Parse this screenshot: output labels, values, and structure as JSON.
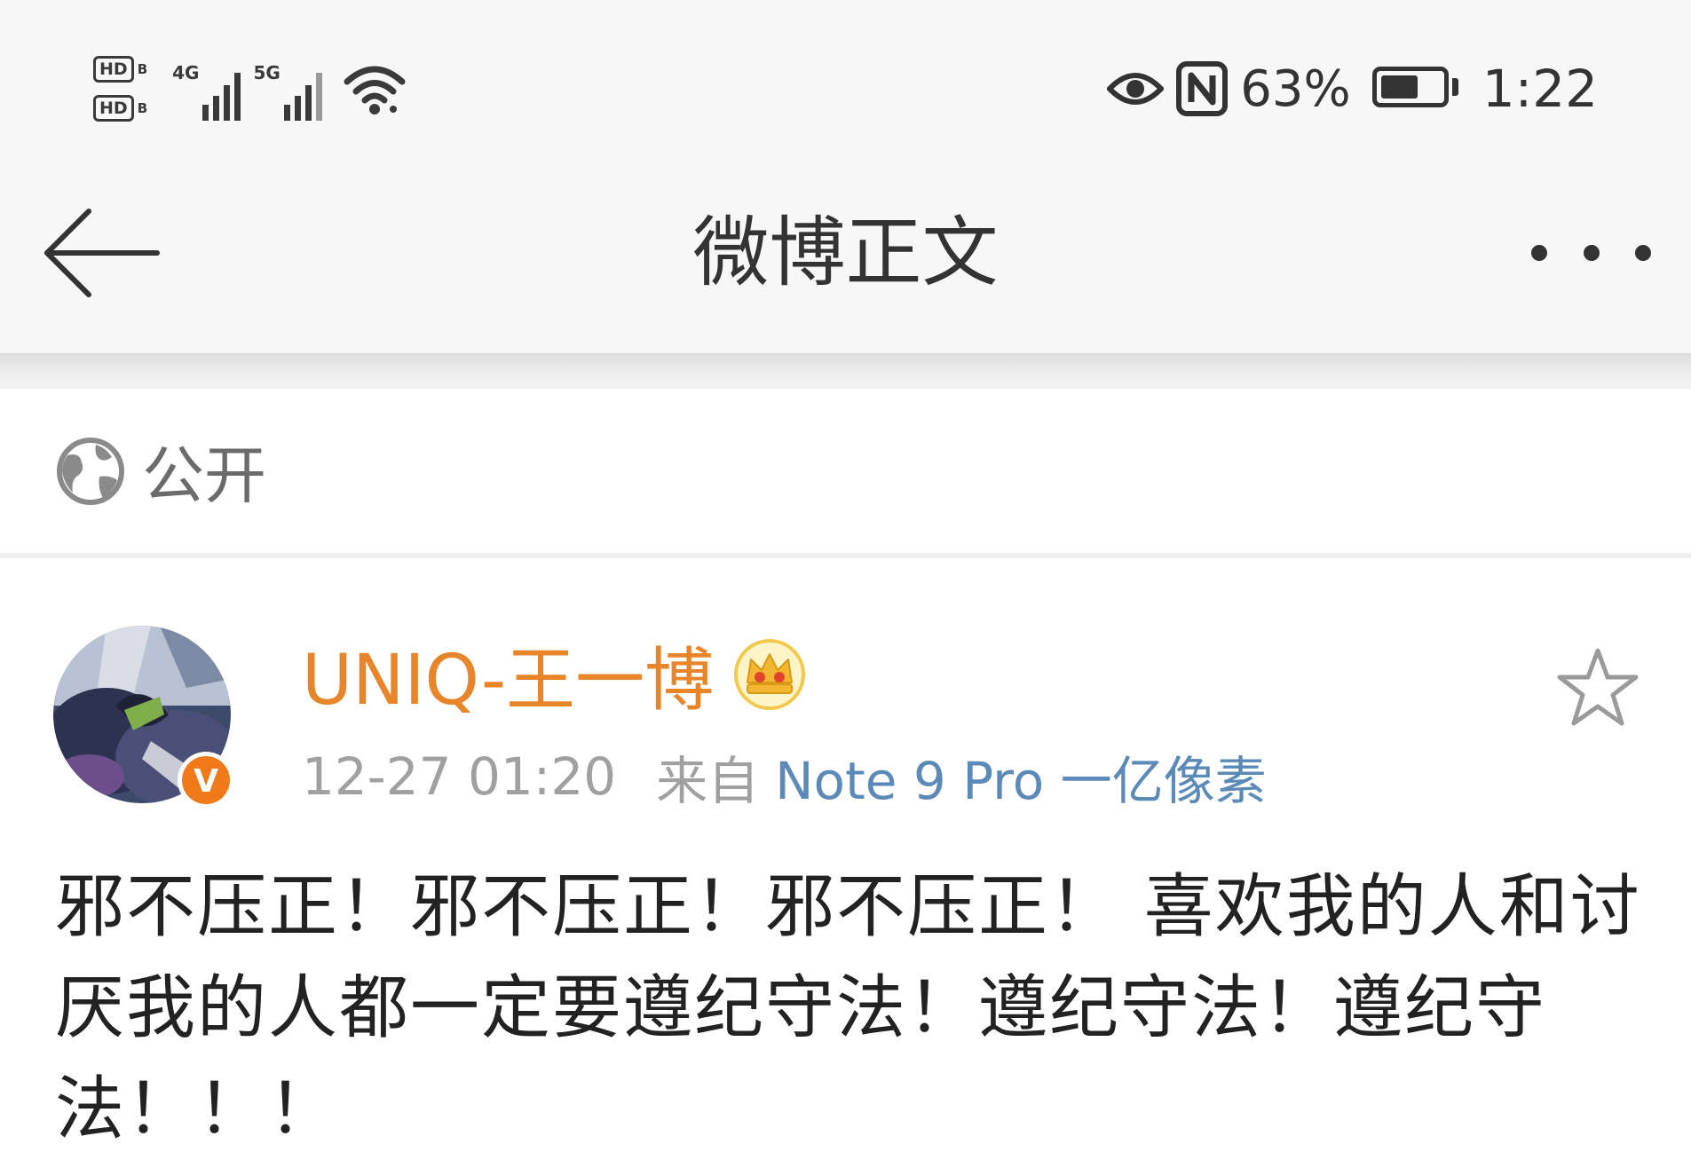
{
  "status_bar": {
    "hd_1": "HD",
    "hd_2": "HD",
    "hd_sub_1": "B",
    "hd_sub_2": "B",
    "network_1": "4G",
    "network_2": "5G",
    "battery_percent": "63%",
    "battery_level": 0.63,
    "time": "1:22",
    "icons": [
      "hd-icon",
      "signal-icon",
      "wifi-icon",
      "eye-icon",
      "nfc-icon",
      "battery-icon"
    ]
  },
  "nav": {
    "title": "微博正文",
    "back_icon": "back-arrow-icon",
    "more_icon": "more-dots-icon"
  },
  "visibility": {
    "icon": "globe-icon",
    "label": "公开"
  },
  "post": {
    "username": "UNIQ-王一博",
    "crown_icon": "crown-icon",
    "verified_icon": "verified-v-icon",
    "verified_text": "V",
    "time": "12-27 01:20",
    "from_label": "来自",
    "device": "Note 9 Pro 一亿像素",
    "favorite_icon": "star-icon",
    "text": "邪不压正！邪不压正！邪不压正！ 喜欢我的人和讨厌我的人都一定要遵纪守法！遵纪守法！遵纪守法！！！"
  },
  "colors": {
    "username": "#e8852b",
    "device_link": "#5b8ab8",
    "meta_gray": "#a0a0a0",
    "bar_bg": "#f7f7f7"
  }
}
